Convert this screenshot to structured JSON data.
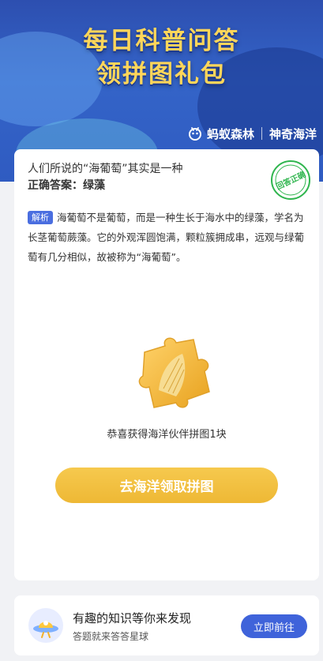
{
  "banner": {
    "title_line1": "每日科普问答",
    "title_line2": "领拼图礼包",
    "brand_left": "蚂蚁森林",
    "brand_right": "神奇海洋"
  },
  "quiz": {
    "question": "人们所说的“海葡萄”其实是一种",
    "answer": "正确答案：绿藻",
    "stamp_text": "回答正确",
    "analysis_tag": "解析",
    "analysis_text": "海葡萄不是葡萄，而是一种生长于海水中的绿藻，学名为长茎葡萄蕨藻。它的外观浑圆饱满，颗粒簇拥成串，远观与绿葡萄有几分相似，故被称为“海葡萄”。",
    "reward_text": "恭喜获得海洋伙伴拼图1块",
    "go_button": "去海洋领取拼图"
  },
  "footer": {
    "title": "有趣的知识等你来发现",
    "subtitle": "答题就来答答星球",
    "button": "立即前往"
  },
  "colors": {
    "banner_blue": "#3464c8",
    "title_yellow": "#ffd65a",
    "stamp_green": "#2fb54e",
    "button_gold": "#f2bf3f",
    "button_blue": "#3f63da"
  },
  "icons": [
    "ant-forest-icon",
    "correct-stamp-icon",
    "puzzle-piece-icon",
    "planet-icon"
  ]
}
